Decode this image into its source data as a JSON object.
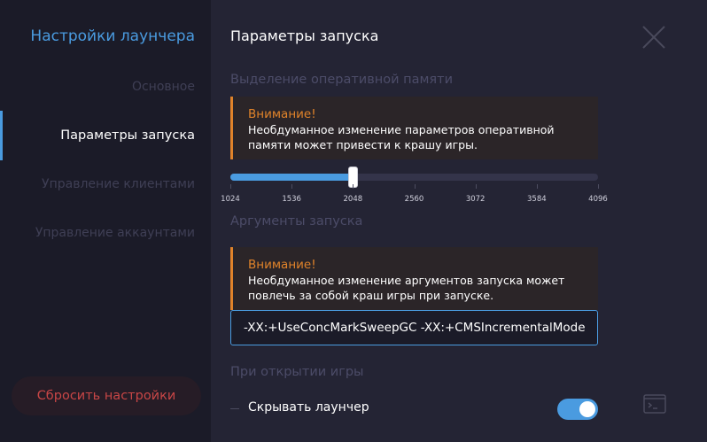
{
  "sidebar": {
    "title": "Настройки лаунчера",
    "items": [
      {
        "label": "Основное",
        "active": false
      },
      {
        "label": "Параметры запуска",
        "active": true
      },
      {
        "label": "Управление клиентами",
        "active": false
      },
      {
        "label": "Управление аккаунтами",
        "active": false
      }
    ],
    "reset_label": "Сбросить настройки"
  },
  "main": {
    "title": "Параметры запуска",
    "memory": {
      "label": "Выделение оперативной памяти",
      "warning_title": "Внимание!",
      "warning_text": "Необдуманное изменение параметров оперативной памяти может привести к крашу игры.",
      "slider": {
        "min": 1024,
        "max": 4096,
        "value": 2048,
        "ticks": [
          "1024",
          "1536",
          "2048",
          "2560",
          "3072",
          "3584",
          "4096"
        ]
      }
    },
    "args": {
      "label": "Аргументы запуска",
      "warning_title": "Внимание!",
      "warning_text": "Необдуманное изменение аргументов запуска может повлечь за собой краш игры при запуске.",
      "value": "-XX:+UseConcMarkSweepGC -XX:+CMSIncrementalMode"
    },
    "on_open": {
      "label": "При открытии игры",
      "hide_launcher_label": "Скрывать лаунчер",
      "hide_launcher_enabled": true
    }
  },
  "colors": {
    "accent": "#4a9be0",
    "warning": "#e0832a",
    "danger": "#c84646",
    "background": "#1b1b28",
    "panel": "#242434"
  },
  "icons": {
    "close": "close-icon",
    "console": "console-icon"
  }
}
